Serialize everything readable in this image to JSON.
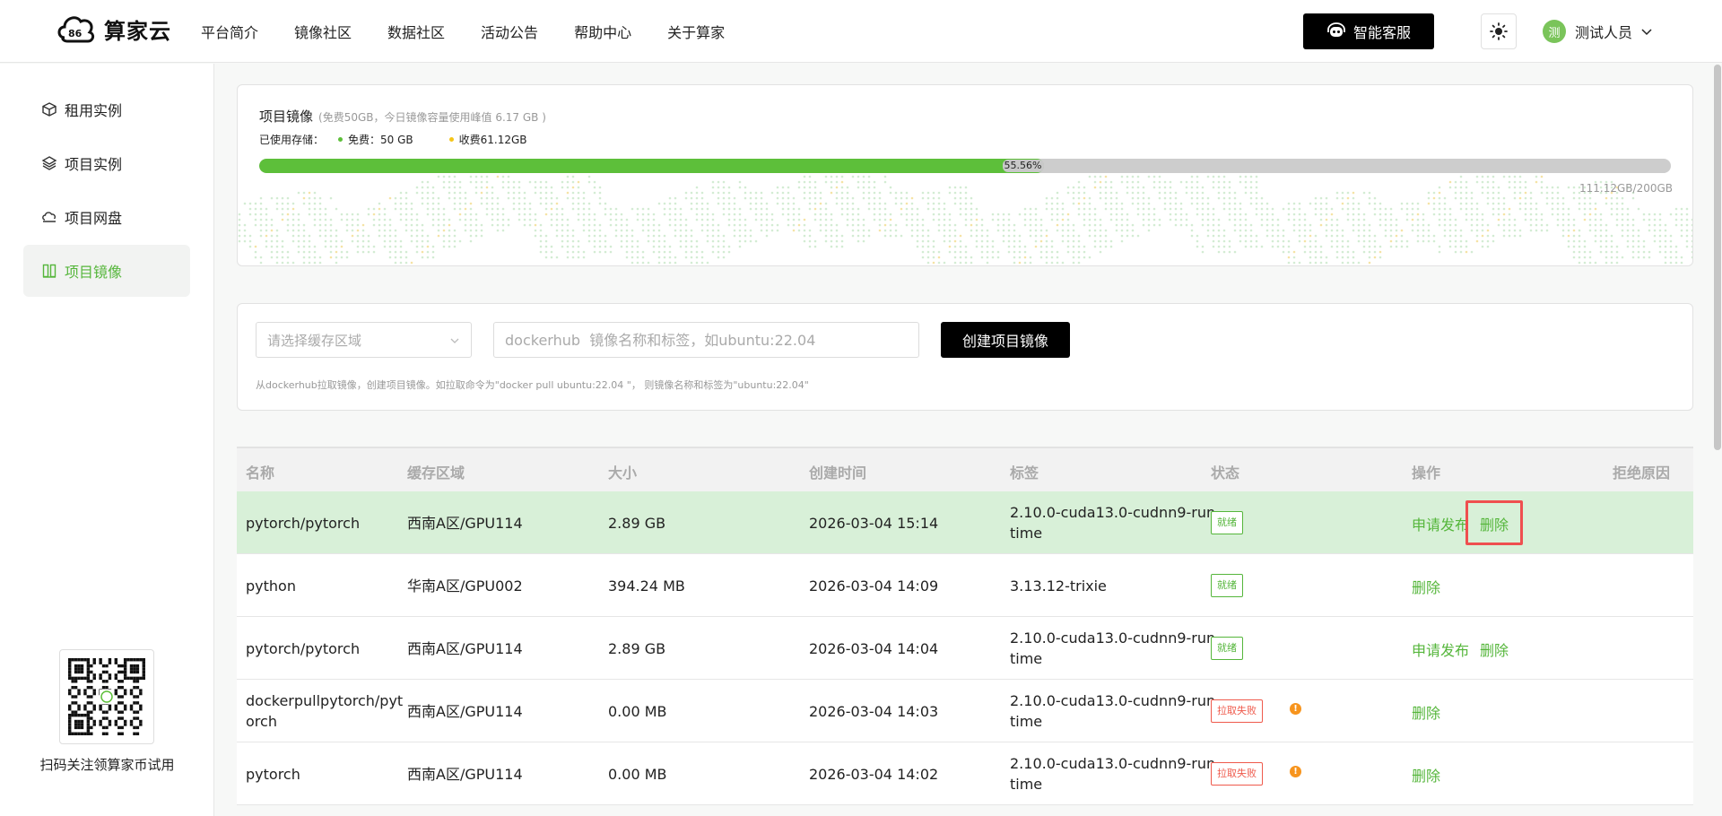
{
  "brand": {
    "name": "算家云"
  },
  "nav": [
    "平台简介",
    "镜像社区",
    "数据社区",
    "活动公告",
    "帮助中心",
    "关于算家"
  ],
  "header": {
    "service_label": "智能客服",
    "user_initial": "测",
    "user_name": "测试人员"
  },
  "sidebar": {
    "items": [
      {
        "label": "租用实例",
        "icon": "cube-icon"
      },
      {
        "label": "项目实例",
        "icon": "layers-icon"
      },
      {
        "label": "项目网盘",
        "icon": "cloud-drive-icon"
      },
      {
        "label": "项目镜像",
        "icon": "image-columns-icon",
        "active": true
      }
    ],
    "qr_caption": "扫码关注领算家币试用"
  },
  "storage": {
    "title": "项目镜像",
    "note": "(免费50GB，今日镜像容量使用峰值 6.17 GB )",
    "used_label": "已使用存储：",
    "free_label": "免费：50 GB",
    "paid_label": "收费61.12GB",
    "percent": 55.56,
    "percent_label": "55.56%",
    "total_label": "111.12GB/200GB",
    "colors": {
      "free": "#5dbf3a",
      "paid": "#f5c518"
    }
  },
  "create": {
    "region_placeholder": "请选择缓存区域",
    "name_placeholder": "dockerhub  镜像名称和标签，如ubuntu:22.04",
    "button_label": "创建项目镜像",
    "hint": "从dockerhub拉取镜像，创建项目镜像。如拉取命令为\"docker pull ubuntu:22.04 \"， 则镜像名称和标签为\"ubuntu:22.04\""
  },
  "table": {
    "columns": [
      "名称",
      "缓存区域",
      "大小",
      "创建时间",
      "标签",
      "状态",
      "操作",
      "拒绝原因"
    ],
    "rows": [
      {
        "name": [
          "pytorch/pytorch"
        ],
        "region": "西南A区/GPU114",
        "size": "2.89 GB",
        "created": "2026-03-04 15:14",
        "tag": [
          "2.10.0-cuda13.0-cudnn9-run",
          "time"
        ],
        "status": "就绪",
        "status_type": "ok",
        "ops": [
          "申请发布",
          "删除"
        ]
      },
      {
        "name": [
          "python"
        ],
        "region": "华南A区/GPU002",
        "size": "394.24 MB",
        "created": "2026-03-04 14:09",
        "tag": [
          "3.13.12-trixie"
        ],
        "status": "就绪",
        "status_type": "ok",
        "ops": [
          "删除"
        ]
      },
      {
        "name": [
          "pytorch/pytorch"
        ],
        "region": "西南A区/GPU114",
        "size": "2.89 GB",
        "created": "2026-03-04 14:04",
        "tag": [
          "2.10.0-cuda13.0-cudnn9-run",
          "time"
        ],
        "status": "就绪",
        "status_type": "ok",
        "ops": [
          "申请发布",
          "删除"
        ]
      },
      {
        "name": [
          "dockerpullpytorch/pyt",
          "orch"
        ],
        "region": "西南A区/GPU114",
        "size": "0.00 MB",
        "created": "2026-03-04 14:03",
        "tag": [
          "2.10.0-cuda13.0-cudnn9-run",
          "time"
        ],
        "status": "拉取失败",
        "status_type": "fail",
        "ops": [
          "删除"
        ]
      },
      {
        "name": [
          "pytorch"
        ],
        "region": "西南A区/GPU114",
        "size": "0.00 MB",
        "created": "2026-03-04 14:02",
        "tag": [
          "2.10.0-cuda13.0-cudnn9-run",
          "time"
        ],
        "status": "拉取失败",
        "status_type": "fail",
        "ops": [
          "删除"
        ]
      }
    ],
    "highlight": {
      "row": 0,
      "op": "删除",
      "color": "#ef4f4f"
    }
  }
}
